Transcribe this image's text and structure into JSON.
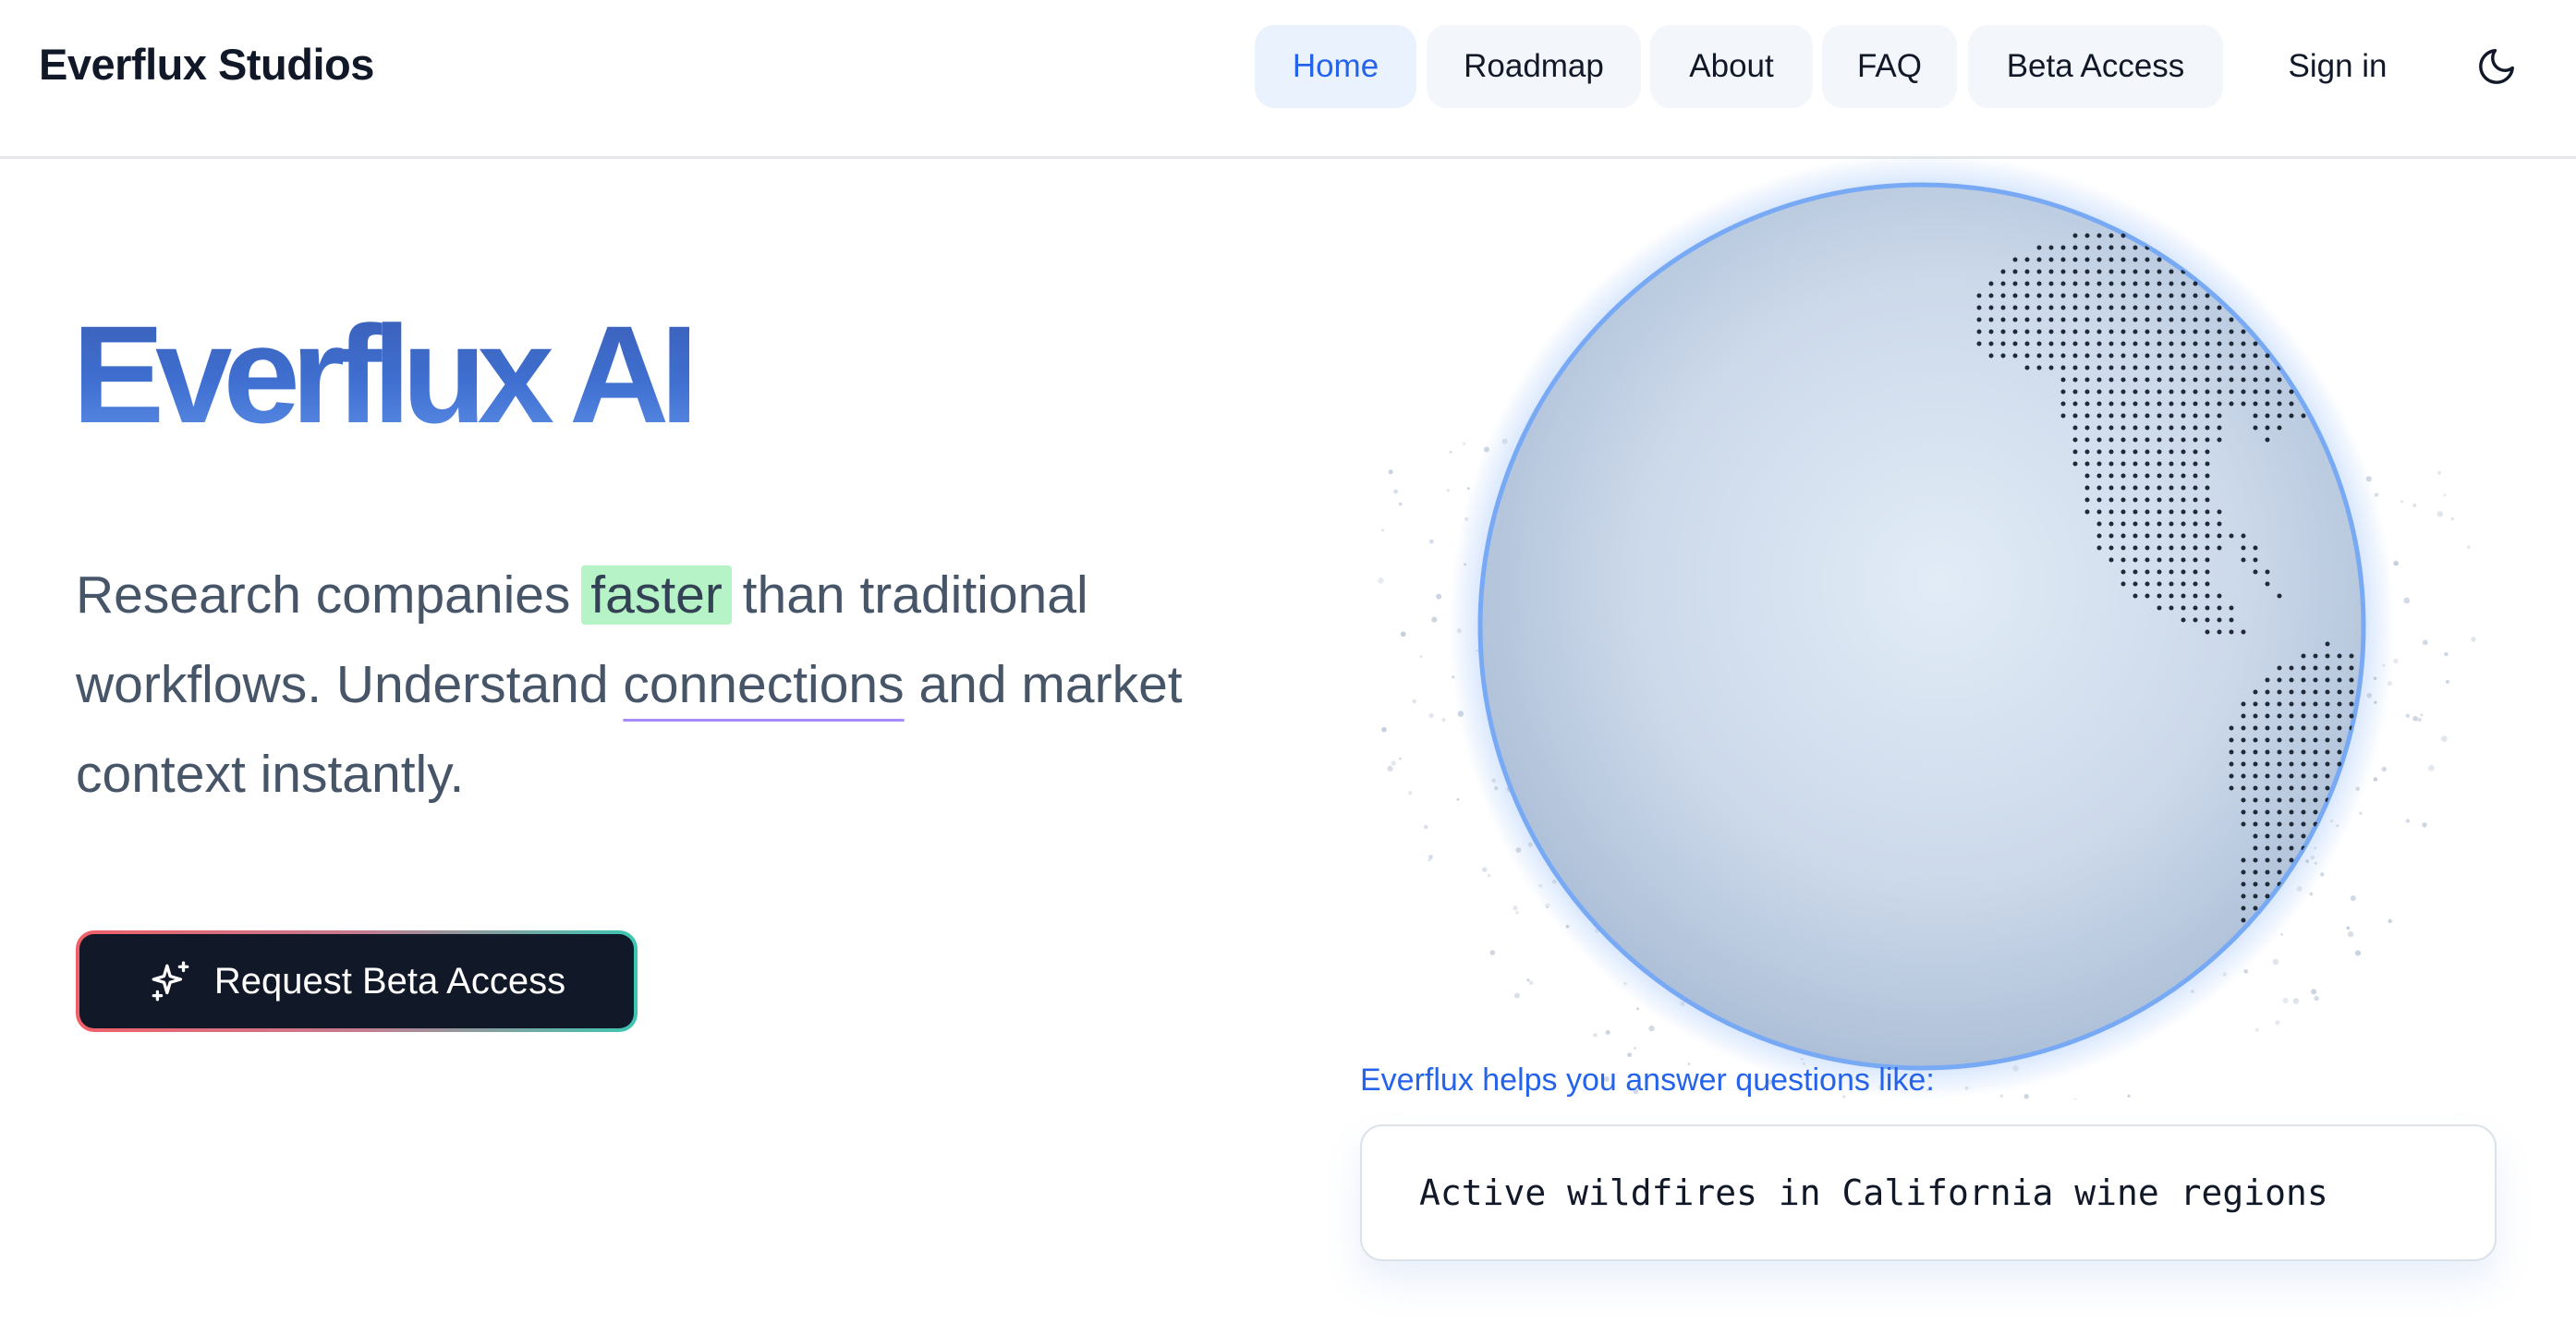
{
  "brand": "Everflux Studios",
  "nav": {
    "items": [
      {
        "label": "Home",
        "active": true
      },
      {
        "label": "Roadmap",
        "active": false
      },
      {
        "label": "About",
        "active": false
      },
      {
        "label": "FAQ",
        "active": false
      },
      {
        "label": "Beta Access",
        "active": false
      }
    ],
    "sign_in": "Sign in",
    "theme_icon": "moon-icon"
  },
  "hero": {
    "title": "Everflux AI",
    "text_part1": "Research companies ",
    "text_highlight": "faster",
    "text_part2": " than traditional workflows. Understand ",
    "text_underline": "connections",
    "text_part3": " and market context instantly.",
    "cta_label": "Request Beta Access",
    "cta_icon": "sparkles-icon"
  },
  "showcase": {
    "caption": "Everflux helps you answer questions like:",
    "query": "Active wildfires in California wine regions"
  },
  "colors": {
    "accent": "#2563eb",
    "title_gradient_top": "#3b5fb8",
    "highlight_green": "#b6f3c6",
    "underline_purple": "#a78bfa",
    "cta_background": "#111827",
    "globe_glow": "#6aa3f5"
  }
}
